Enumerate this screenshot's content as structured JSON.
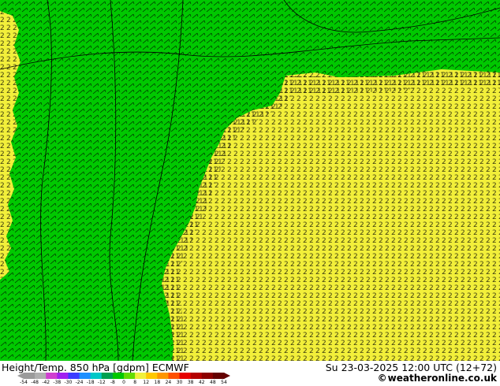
{
  "title": {
    "left": "Height/Temp. 850 hPa [gdpm] ECMWF",
    "right": "Su 23-03-2025 12:00 UTC (12+72)"
  },
  "credit": {
    "prefix": "©",
    "text": "weatheronline.co.uk"
  },
  "map": {
    "colors": {
      "green": "#00c800",
      "yellow": "#f2ef3a",
      "contour": "#000000"
    },
    "icon": "wind-barb-field-map"
  },
  "colorbar": {
    "labels": [
      "-54",
      "-48",
      "-42",
      "-38",
      "-30",
      "-24",
      "-18",
      "-12",
      "-8",
      "0",
      "8",
      "12",
      "18",
      "24",
      "30",
      "38",
      "42",
      "48",
      "54"
    ],
    "colors": [
      "#9b9b9b",
      "#b0b0b0",
      "#d040d0",
      "#a020f0",
      "#3c3cff",
      "#1e90ff",
      "#00c8c8",
      "#00a050",
      "#00c800",
      "#64dc00",
      "#f0f03c",
      "#ffc800",
      "#ff9600",
      "#ff5000",
      "#e60000",
      "#b40000",
      "#8c0000",
      "#640000"
    ]
  }
}
